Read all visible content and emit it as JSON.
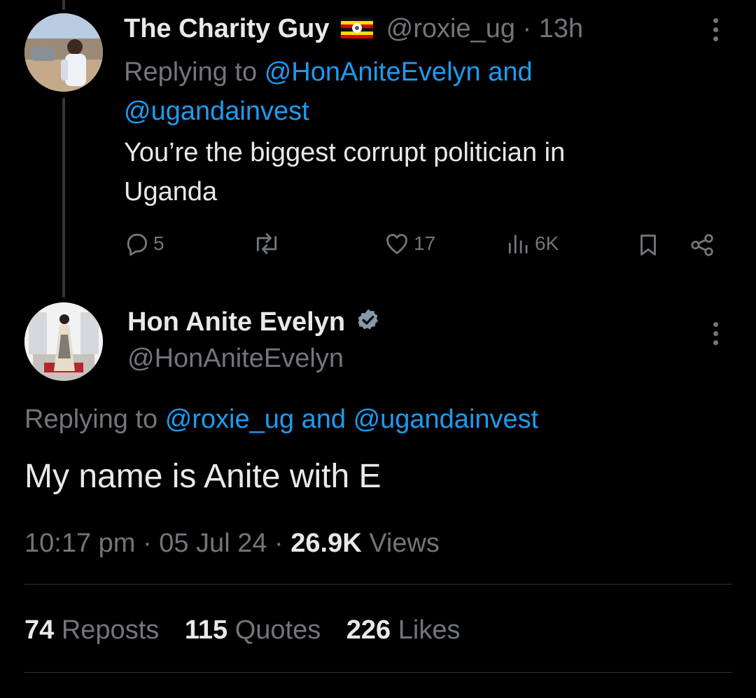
{
  "reply_tweet": {
    "display_name": "The Charity Guy",
    "flag_icon": "uganda-flag",
    "handle": "@roxie_ug",
    "separator": "·",
    "time": "13h",
    "replying_label": "Replying to",
    "replying_user1": "@HonAniteEvelyn",
    "replying_and": "and",
    "replying_user2": "@ugandainvest",
    "text_line1": "You’re the biggest corrupt politician in",
    "text_line2": "Uganda",
    "actions": {
      "replies": "5",
      "reposts": "",
      "likes": "17",
      "views": "6K"
    }
  },
  "main_tweet": {
    "display_name": "Hon Anite Evelyn",
    "verified_icon": "verified-badge",
    "handle": "@HonAniteEvelyn",
    "replying_label": "Replying to",
    "replying_user1": "@roxie_ug",
    "replying_and": "and",
    "replying_user2": "@ugandainvest",
    "text": "My name is Anite with E",
    "time": "10:17 pm",
    "sep1": "·",
    "date": "05 Jul 24",
    "sep2": "·",
    "views_count": "26.9K",
    "views_label": "Views",
    "stats": {
      "reposts_count": "74",
      "reposts_label": "Reposts",
      "quotes_count": "115",
      "quotes_label": "Quotes",
      "likes_count": "226",
      "likes_label": "Likes"
    }
  },
  "colors": {
    "background": "#000000",
    "text": "#e7e9ea",
    "muted": "#71767b",
    "link": "#1d9bf0",
    "verified": "#829aab"
  }
}
